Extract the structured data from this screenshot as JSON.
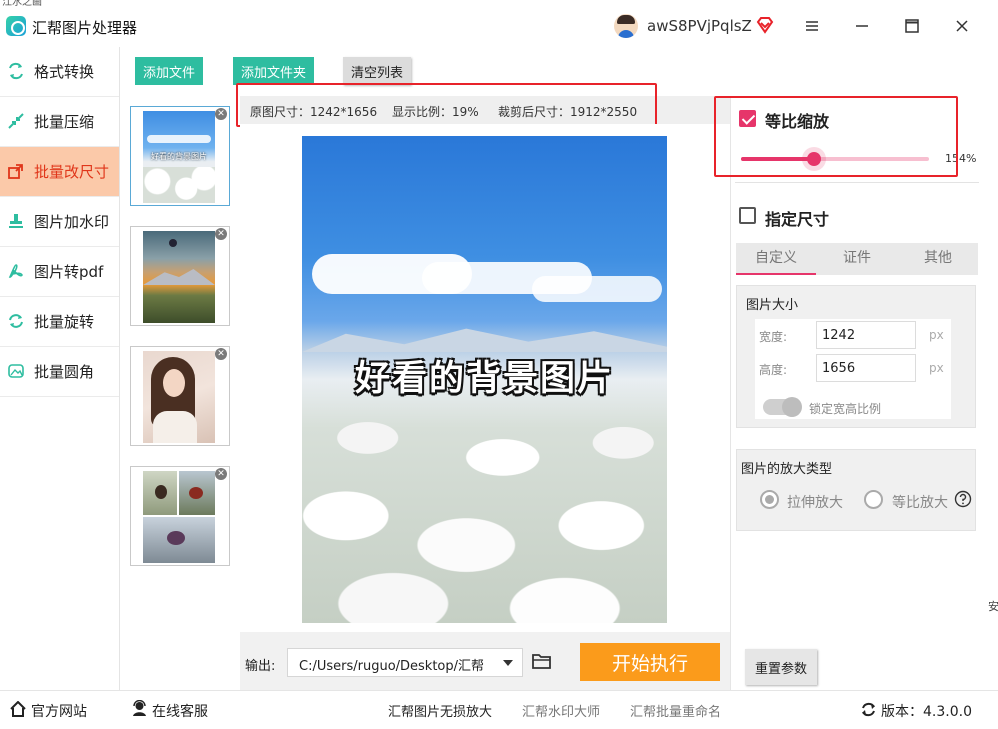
{
  "edge": {
    "top_text": "江水之画"
  },
  "titlebar": {
    "app_title": "汇帮图片处理器",
    "user_name": "awS8PVjPqlsZ"
  },
  "sidebar": {
    "items": [
      {
        "label": "格式转换",
        "icon": "format-convert-icon"
      },
      {
        "label": "批量压缩",
        "icon": "compress-icon"
      },
      {
        "label": "批量改尺寸",
        "icon": "resize-icon",
        "active": true
      },
      {
        "label": "图片加水印",
        "icon": "watermark-icon"
      },
      {
        "label": "图片转pdf",
        "icon": "pdf-icon"
      },
      {
        "label": "批量旋转",
        "icon": "rotate-icon"
      },
      {
        "label": "批量圆角",
        "icon": "round-corner-icon"
      }
    ]
  },
  "toolbar": {
    "add_file": "添加文件",
    "add_folder": "添加文件夹",
    "clear_list": "清空列表"
  },
  "thumbnails": [
    {
      "name": "sky-flowers",
      "caption": "好看的背景图片",
      "selected": true
    },
    {
      "name": "mountain-sunset"
    },
    {
      "name": "girl-portrait"
    },
    {
      "name": "birds-collage"
    }
  ],
  "info": {
    "original_size": "原图尺寸：1242*1656",
    "display_ratio": "显示比例：19%",
    "cropped_size": "裁剪后尺寸：1912*2550"
  },
  "preview": {
    "caption": "好看的背景图片"
  },
  "output": {
    "label": "输出:",
    "path": "C:/Users/ruguo/Desktop/汇帮",
    "start_label": "开始执行"
  },
  "settings": {
    "proportional_label": "等比缩放",
    "proportional_checked": true,
    "scale_value": "154%",
    "scale_fraction": 0.39,
    "specify_size_label": "指定尺寸",
    "specify_size_checked": false,
    "tabs": [
      "自定义",
      "证件",
      "其他"
    ],
    "image_size_title": "图片大小",
    "width_label": "宽度:",
    "width_value": "1242",
    "height_label": "高度:",
    "height_value": "1656",
    "unit": "px",
    "lock_ratio_label": "锁定宽高比例",
    "enlarge_type_title": "图片的放大类型",
    "stretch_label": "拉伸放大",
    "proportional_enlarge_label": "等比放大",
    "help_icon": "question-icon",
    "reset_label": "重置参数"
  },
  "footer": {
    "official_site": "官方网站",
    "online_service": "在线客服",
    "links": [
      "汇帮图片无损放大",
      "汇帮水印大师",
      "汇帮批量重命名"
    ],
    "version": "版本：4.3.0.0"
  },
  "right_edge_text": "安",
  "colors": {
    "accent": "#e6356a",
    "green": "#2ebda0",
    "orange": "#fb9b1b",
    "active_bg": "#fbc9a9",
    "highlight": "#e8232a"
  }
}
